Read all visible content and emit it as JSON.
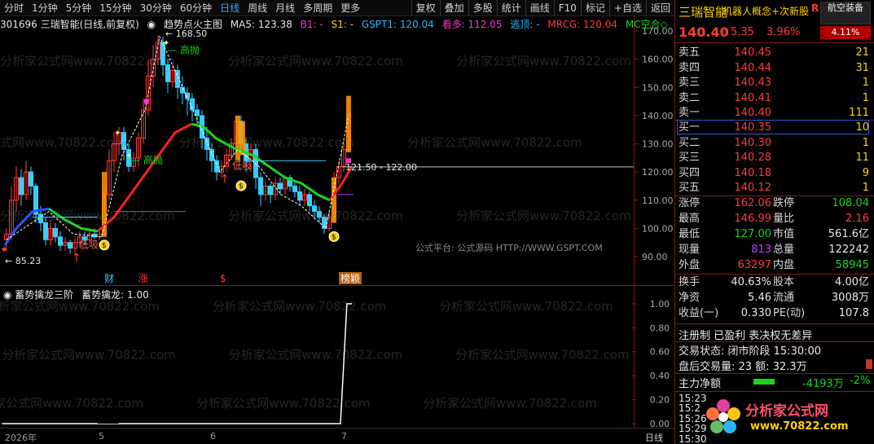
{
  "toolbar": {
    "left": [
      "分时",
      "1分钟",
      "5分钟",
      "15分钟",
      "30分钟",
      "60分钟",
      "日线",
      "周线",
      "月线",
      "多周期",
      "更多"
    ],
    "active": "日线",
    "right": [
      "复权",
      "叠加",
      "多股",
      "统计",
      "画线",
      "F10",
      "标记",
      "+自选",
      "返回"
    ]
  },
  "chart": {
    "code_name": "301696 三瑞智能(日线,前复权)",
    "indicator_name": "趋势点火主图",
    "ma5": "MA5: 123.38",
    "b1": "B1: -",
    "s1": "S1: -",
    "gspt": "GSPT1: 120.04",
    "kanduo": "看多: 112.05",
    "taoding": "逃顶: -",
    "mrcg": "MRCG: 120.04",
    "mc": "MC空合◇",
    "high_label": "168.50",
    "low_label": "85.23",
    "range_label": "121.50 - 122.00",
    "gaopao1": "高抛",
    "gaopao2": "高抛",
    "dixi1": "低吸",
    "dixi2": "低吸",
    "markers": [
      "财",
      "涨",
      "$",
      "榜颖"
    ],
    "source": "公式平台: 公式源码 HTTP://WWW.GSPT.COM",
    "watermark": "分析家公式网www.70822.com",
    "yticks": [
      "170.00",
      "160.00",
      "150.00",
      "140.00",
      "130.00",
      "120.00",
      "110.00",
      "100.00",
      "90.00"
    ]
  },
  "subchart": {
    "title": "蓄势擒龙三阶",
    "value": "蓄势擒龙: 1.00",
    "yticks": [
      "1.00",
      "0.80",
      "0.60",
      "0.40",
      "0.20",
      "0.00"
    ]
  },
  "timeaxis": {
    "labels": [
      "2026年",
      "5",
      "6",
      "7"
    ],
    "period": "日线"
  },
  "panel": {
    "name": "三瑞智能",
    "concept": "机器人概念+次新股",
    "badge": "R",
    "sector": "航空装备",
    "sector_pct": "4.11%",
    "price": "140.40",
    "change": "5.35",
    "pct": "3.96%",
    "asks": [
      {
        "label": "卖五",
        "price": "140.45",
        "vol": "21"
      },
      {
        "label": "卖四",
        "price": "140.44",
        "vol": "31"
      },
      {
        "label": "卖三",
        "price": "140.43",
        "vol": "1"
      },
      {
        "label": "卖二",
        "price": "140.41",
        "vol": "1"
      },
      {
        "label": "卖一",
        "price": "140.40",
        "vol": "111"
      }
    ],
    "bids": [
      {
        "label": "买一",
        "price": "140.35",
        "vol": "10"
      },
      {
        "label": "买二",
        "price": "140.30",
        "vol": "1"
      },
      {
        "label": "买三",
        "price": "140.28",
        "vol": "11"
      },
      {
        "label": "买四",
        "price": "140.18",
        "vol": "9"
      },
      {
        "label": "买五",
        "price": "140.12",
        "vol": "1"
      }
    ],
    "stats": [
      {
        "k1": "涨停",
        "v1": "162.06",
        "c1": "red",
        "k2": "跌停",
        "v2": "108.04",
        "c2": "green"
      },
      {
        "k1": "最高",
        "v1": "146.99",
        "c1": "red",
        "k2": "量比",
        "v2": "2.16",
        "c2": "red"
      },
      {
        "k1": "最低",
        "v1": "127.00",
        "c1": "green",
        "k2": "市值",
        "v2": "561.6亿",
        "c2": "white"
      },
      {
        "k1": "现量",
        "v1": "813",
        "c1": "purple",
        "k2": "总量",
        "v2": "122242",
        "c2": "white"
      },
      {
        "k1": "外盘",
        "v1": "63297",
        "c1": "red",
        "k2": "内盘",
        "v2": "58945",
        "c2": "green"
      }
    ],
    "fin": [
      {
        "k1": "换手",
        "v1": "40.63%",
        "k2": "股本",
        "v2": "4.00亿"
      },
      {
        "k1": "净资",
        "v1": "5.46",
        "k2": "流通",
        "v2": "3008万"
      },
      {
        "k1": "收益(一)",
        "v1": "0.330",
        "k2": "PE(动)",
        "v2": "107.8"
      }
    ],
    "tags": "注册制 已盈利 表决权无差异",
    "trade_state": "交易状态: 闭市阶段 15:30:00",
    "after_hours": "盘后交易量: 23  额: 32.3万",
    "netflow_label": "主力净额",
    "netflow_value": "-4193万",
    "netflow_pct": "-2%",
    "ticks": [
      "15:23",
      "15:2",
      "15:26",
      "15:29",
      "15:30"
    ],
    "logo_text": "分析家公式网",
    "logo_url": "www.70822.com"
  }
}
